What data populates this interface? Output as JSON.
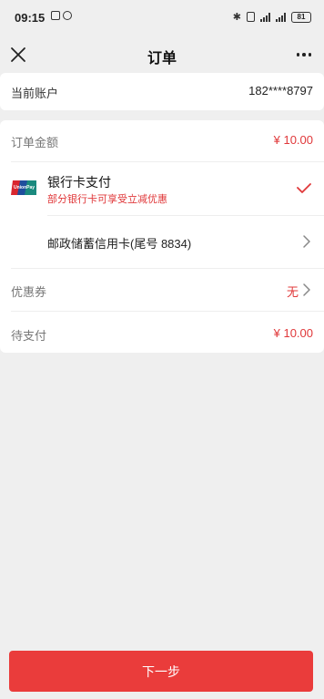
{
  "status_bar": {
    "time": "09:15",
    "battery": "81",
    "icons": [
      "sim-icon",
      "notification-icon",
      "bluetooth-icon",
      "vibrate-icon",
      "signal-icon",
      "signal-icon",
      "battery-icon"
    ]
  },
  "header": {
    "title": "订单",
    "close_icon": "close-icon",
    "more_icon": "more-icon"
  },
  "account": {
    "label": "当前账户",
    "value": "182****8797"
  },
  "order": {
    "amount_label": "订单金额",
    "amount_value": "¥ 10.00",
    "payment_method": {
      "icon": "unionpay-icon",
      "title": "银行卡支付",
      "promo": "部分银行卡可享受立减优惠",
      "selected": true
    },
    "card_name": "邮政储蓄信用卡(尾号 8834)",
    "coupon_label": "优惠券",
    "coupon_value": "无",
    "pending_label": "待支付",
    "pending_value": "¥ 10.00"
  },
  "footer": {
    "next_label": "下一步"
  },
  "colors": {
    "accent": "#e0383a",
    "button": "#ea3c3b",
    "background": "#efefef"
  }
}
